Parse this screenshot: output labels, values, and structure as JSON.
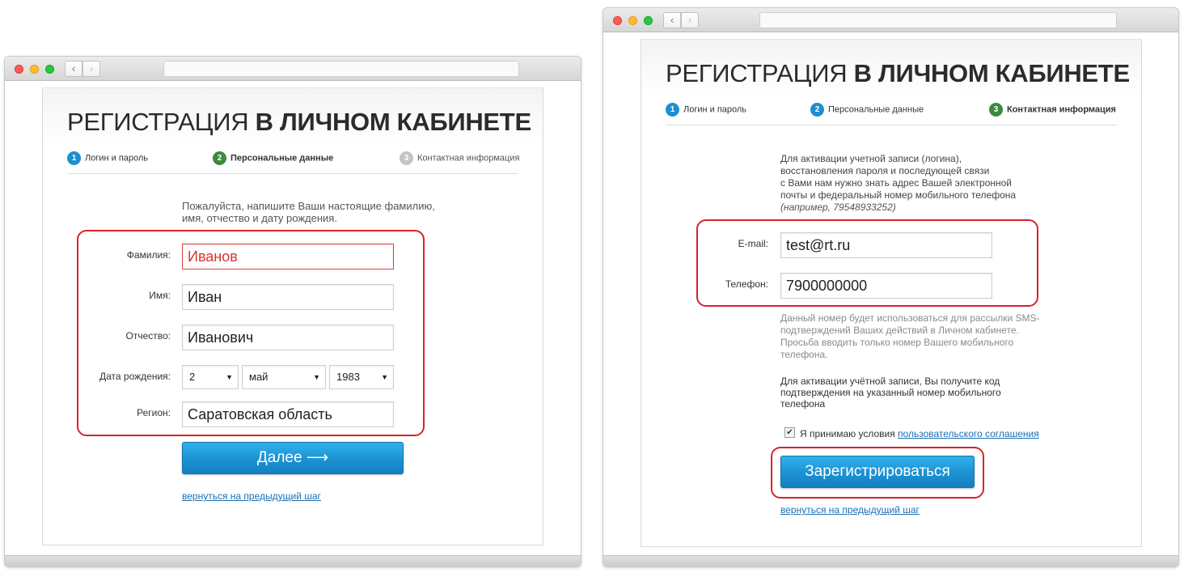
{
  "left_window": {
    "heading_light": "РЕГИСТРАЦИЯ",
    "heading_bold": "В ЛИЧНОМ КАБИНЕТЕ",
    "steps": [
      {
        "num": "1",
        "label": "Логин и пароль"
      },
      {
        "num": "2",
        "label": "Персональные данные"
      },
      {
        "num": "3",
        "label": "Контактная информация"
      }
    ],
    "intro": "Пожалуйста, напишите Ваши настоящие фамилию, имя, отчество и дату рождения.",
    "form": {
      "surname_label": "Фамилия:",
      "surname_value": "Иванов",
      "name_label": "Имя:",
      "name_value": "Иван",
      "patronymic_label": "Отчество:",
      "patronymic_value": "Иванович",
      "birthdate_label": "Дата рождения:",
      "birth_day": "2",
      "birth_month": "май",
      "birth_year": "1983",
      "region_label": "Регион:",
      "region_value": "Саратовская область"
    },
    "next_button": "Далее ⟶",
    "back_link": "вернуться на предыдущий шаг"
  },
  "right_window": {
    "heading_light": "РЕГИСТРАЦИЯ",
    "heading_bold": "В ЛИЧНОМ КАБИНЕТЕ",
    "steps": [
      {
        "num": "1",
        "label": "Логин и пароль"
      },
      {
        "num": "2",
        "label": "Персональные данные"
      },
      {
        "num": "3",
        "label": "Контактная информация"
      }
    ],
    "intro_lines": [
      "Для активации учетной записи (логина),",
      "восстановления пароля и последующей связи",
      "с Вами нам нужно знать адрес Вашей электронной",
      "почты и федеральный номер мобильного телефона"
    ],
    "intro_example": "(например, 79548933252)",
    "form": {
      "email_label": "E-mail:",
      "email_value": "test@rt.ru",
      "phone_label": "Телефон:",
      "phone_value": "7900000000"
    },
    "sms_note_lines": [
      "Данный номер будет использоваться для рассылки SMS-",
      "подтверждений Ваших действий в Личном кабинете.",
      "Просьба вводить только номер Вашего мобильного",
      "телефона."
    ],
    "activation_note_lines": [
      "Для активации учётной записи, Вы получите код",
      "подтверждения на указанный номер мобильного",
      "телефона"
    ],
    "agree_text": "Я принимаю условия",
    "agree_link": "пользовательского соглашения",
    "register_button": "Зарегистрироваться",
    "back_link": "вернуться на предыдущий шаг"
  },
  "icons": {
    "back": "‹",
    "forward": "›",
    "dropdown": "▼",
    "check": "✔"
  },
  "colors": {
    "accent_blue": "#1d94d5",
    "step_green": "#3b8a3e",
    "highlight_red": "#d8232a",
    "error_red": "#e04040"
  }
}
